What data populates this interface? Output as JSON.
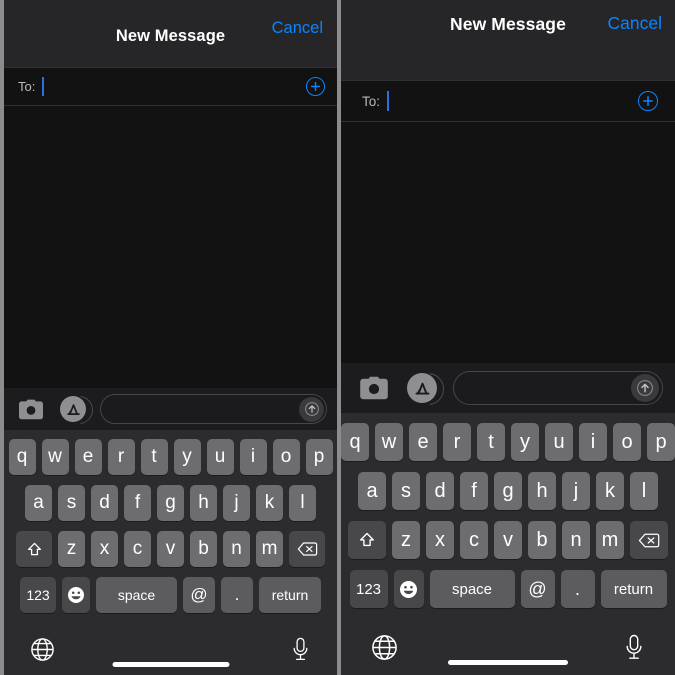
{
  "meta": {
    "colors": {
      "accent_blue": "#0a84ff",
      "caret_blue": "#2b6fe3",
      "screen_bg": "#121212",
      "nav_bg": "#262628",
      "keyboard_bg": "#2c2c2e",
      "key_light": "#6d6d70",
      "key_dark": "#48484a",
      "divider": "#8c8c8c"
    }
  },
  "panels": [
    {
      "id": "left",
      "navbar": {
        "title": "New Message",
        "cancel_label": "Cancel"
      },
      "to_field": {
        "label": "To:",
        "value": "",
        "placeholder": "",
        "add_contact_icon": "plus-circle-icon"
      },
      "compose": {
        "camera_icon": "camera-icon",
        "appstore_icon": "app-store-icon",
        "message_value": "",
        "message_placeholder": "",
        "send_icon": "send-arrow-up-icon"
      },
      "keyboard": {
        "row1": [
          "q",
          "w",
          "e",
          "r",
          "t",
          "y",
          "u",
          "i",
          "o",
          "p"
        ],
        "row2": [
          "a",
          "s",
          "d",
          "f",
          "g",
          "h",
          "j",
          "k",
          "l"
        ],
        "row3": [
          "z",
          "x",
          "c",
          "v",
          "b",
          "n",
          "m"
        ],
        "shift_icon": "shift-up-arrow-icon",
        "backspace_icon": "backspace-delete-icon",
        "numeric_label": "123",
        "emoji_icon": "smiley-emoji-icon",
        "space_label": "space",
        "at_label": "@",
        "dot_label": ".",
        "return_label": "return",
        "globe_icon": "globe-language-icon",
        "mic_icon": "microphone-dictation-icon"
      }
    },
    {
      "id": "right",
      "navbar": {
        "title": "New Message",
        "cancel_label": "Cancel"
      },
      "to_field": {
        "label": "To:",
        "value": "",
        "placeholder": "",
        "add_contact_icon": "plus-circle-icon"
      },
      "compose": {
        "camera_icon": "camera-icon",
        "appstore_icon": "app-store-icon",
        "message_value": "",
        "message_placeholder": "",
        "send_icon": "send-arrow-up-icon"
      },
      "keyboard": {
        "row1": [
          "q",
          "w",
          "e",
          "r",
          "t",
          "y",
          "u",
          "i",
          "o",
          "p"
        ],
        "row2": [
          "a",
          "s",
          "d",
          "f",
          "g",
          "h",
          "j",
          "k",
          "l"
        ],
        "row3": [
          "z",
          "x",
          "c",
          "v",
          "b",
          "n",
          "m"
        ],
        "shift_icon": "shift-up-arrow-icon",
        "backspace_icon": "backspace-delete-icon",
        "numeric_label": "123",
        "emoji_icon": "smiley-emoji-icon",
        "space_label": "space",
        "at_label": "@",
        "dot_label": ".",
        "return_label": "return",
        "globe_icon": "globe-language-icon",
        "mic_icon": "microphone-dictation-icon"
      }
    }
  ]
}
